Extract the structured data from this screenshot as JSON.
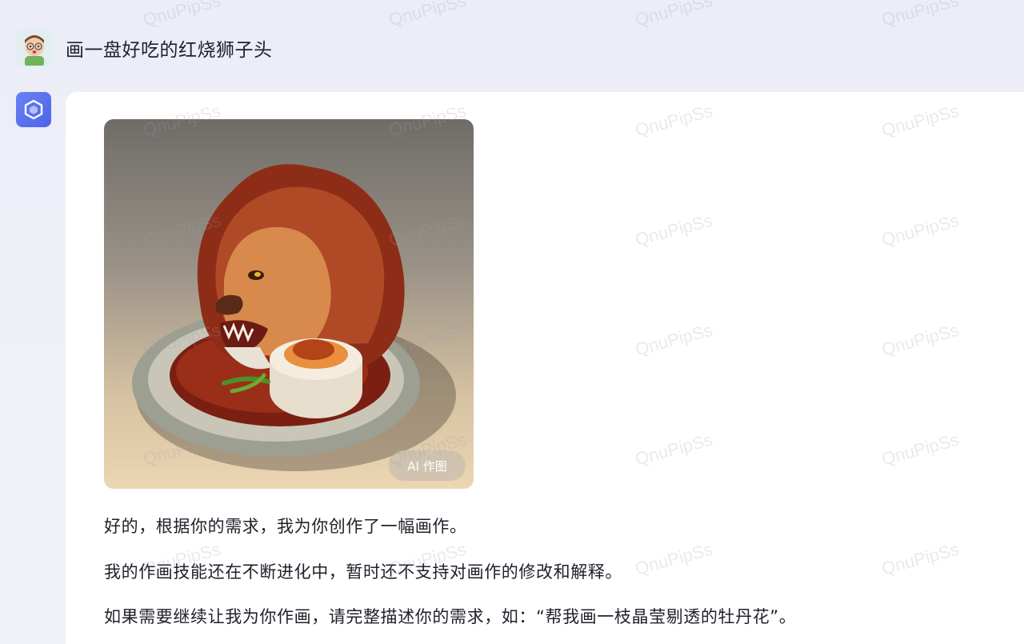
{
  "user_message": {
    "text": "画一盘好吃的红烧狮子头"
  },
  "reply": {
    "image_badge": "AI 作图",
    "paragraphs": [
      "好的，根据你的需求，我为你创作了一幅画作。",
      "我的作画技能还在不断进化中，暂时还不支持对画作的修改和解释。",
      "如果需要继续让我为你作画，请完整描述你的需求，如：“帮我画一枝晶莹剔透的牡丹花”。"
    ]
  },
  "watermark": "QnuPipSs",
  "colors": {
    "bot_accent": "#5b72ef",
    "text": "#1f2029",
    "card_bg": "#ffffff"
  },
  "icons": {
    "user_avatar": "cartoon-person-icon",
    "bot_avatar": "cube-logo-icon"
  }
}
